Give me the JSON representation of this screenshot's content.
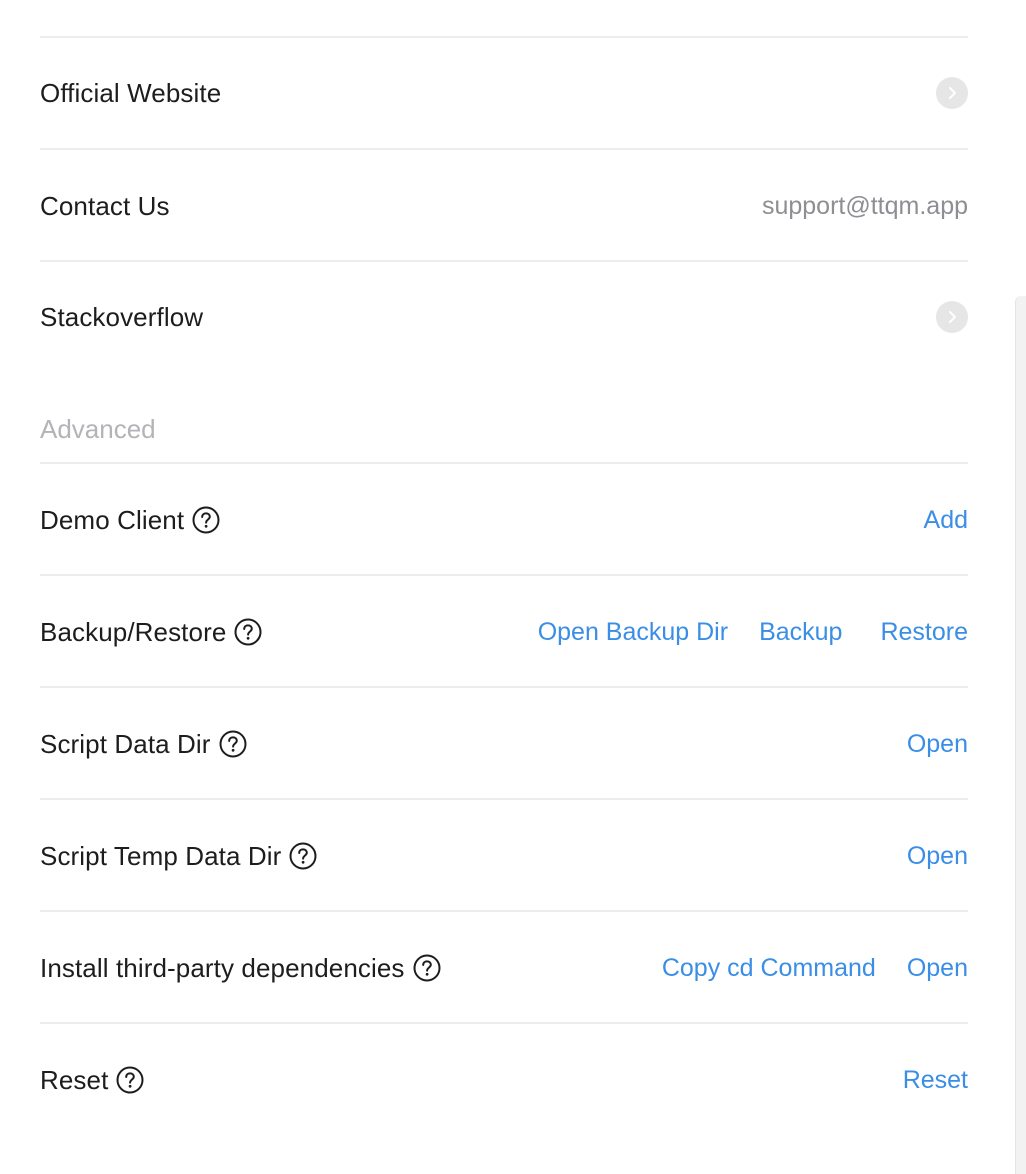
{
  "links": {
    "official_website": {
      "label": "Official Website",
      "icon": "chevron-right-icon"
    },
    "contact_us": {
      "label": "Contact Us",
      "value": "support@ttqm.app"
    },
    "stackoverflow": {
      "label": "Stackoverflow",
      "icon": "chevron-right-icon"
    }
  },
  "advanced": {
    "title": "Advanced",
    "demo_client": {
      "label": "Demo Client",
      "actions": [
        "Add"
      ]
    },
    "backup_restore": {
      "label": "Backup/Restore",
      "actions": [
        "Open Backup Dir",
        "Backup",
        "Restore"
      ]
    },
    "script_data_dir": {
      "label": "Script Data Dir",
      "actions": [
        "Open"
      ]
    },
    "script_temp_data_dir": {
      "label": "Script Temp Data Dir",
      "actions": [
        "Open"
      ]
    },
    "install_deps": {
      "label": "Install third-party dependencies",
      "actions": [
        "Copy cd Command",
        "Open"
      ]
    },
    "reset": {
      "label": "Reset",
      "actions": [
        "Reset"
      ]
    }
  },
  "colors": {
    "link": "#3a8ee6",
    "muted": "#8e8e93",
    "section_header": "#b4b4b8",
    "divider": "#ececec"
  }
}
